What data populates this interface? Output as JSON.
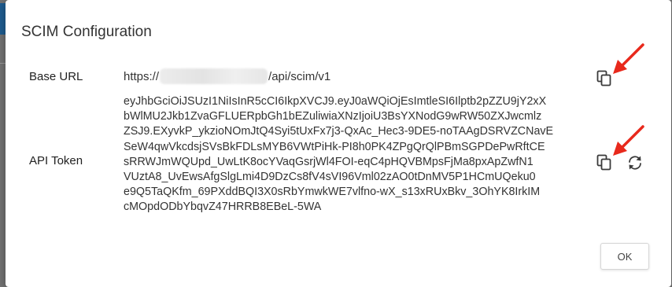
{
  "dialog": {
    "title": "SCIM Configuration",
    "ok_label": "OK"
  },
  "base_url": {
    "label": "Base URL",
    "prefix": "https://",
    "suffix": "/api/scim/v1"
  },
  "api_token": {
    "label": "API Token",
    "lines": [
      "eyJhbGciOiJSUzI1NiIsInR5cCI6IkpXVCJ9.eyJ0aWQiOjEsImtleSI6Ilptb2pZZU9jY2xX",
      "bWlMU2Jkb1ZvaGFLUERpbGh1bEZuliwiaXNzIjoiU3BsYXNodG9wRW50ZXJwcmlz",
      "ZSJ9.EXyvkP_ykzioNOmJtQ4Syi5tUxFx7j3-QxAc_Hec3-9DE5-noTAAgDSRVZCNavE",
      "SeW4qwVkcdsjSVsBkFDLsMYB6VWtPiHk-PI8h0PK4ZPgQrQlPBmSGPDePwRftCE",
      "sRRWJmWQUpd_UwLtK8ocYVaqGsrjWl4FOI-eqC4pHQVBMpsFjMa8pxApZwfN1",
      "VUztA8_UvEwsAfgSlgLmi4D9DzCs8fV4sVI96Vml02zAO0tDnMV5P1HCmUQeku0",
      "e9Q5TaQKfm_69PXddBQI3X0sRbYmwkWE7vlfno-wX_s13xRUxBkv_3OhYK8IrkIM",
      "cMOpdODbYbqvZ47HRRB8EBeL-5WA"
    ]
  },
  "icons": {
    "copy": "copy-icon",
    "refresh": "refresh-icon",
    "annotation": "red-arrow-annotation"
  },
  "colors": {
    "annotation_red": "#e8291c",
    "text": "#333333",
    "icon": "#3a3a3a"
  }
}
